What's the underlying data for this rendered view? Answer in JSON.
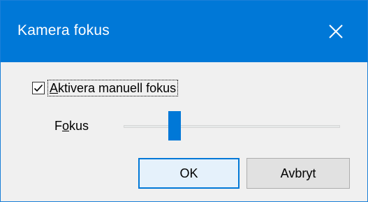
{
  "window": {
    "title": "Kamera fokus",
    "close_icon": "close-icon",
    "accent_color": "#0078d7"
  },
  "manual_focus": {
    "checked": true,
    "label_accel": "A",
    "label_rest": "ktivera manuell fokus"
  },
  "focus": {
    "label_pre": "F",
    "label_accel": "o",
    "label_rest": "kus",
    "slider_value_fraction": 0.2
  },
  "buttons": {
    "ok_label": "OK",
    "cancel_label": "Avbryt"
  }
}
